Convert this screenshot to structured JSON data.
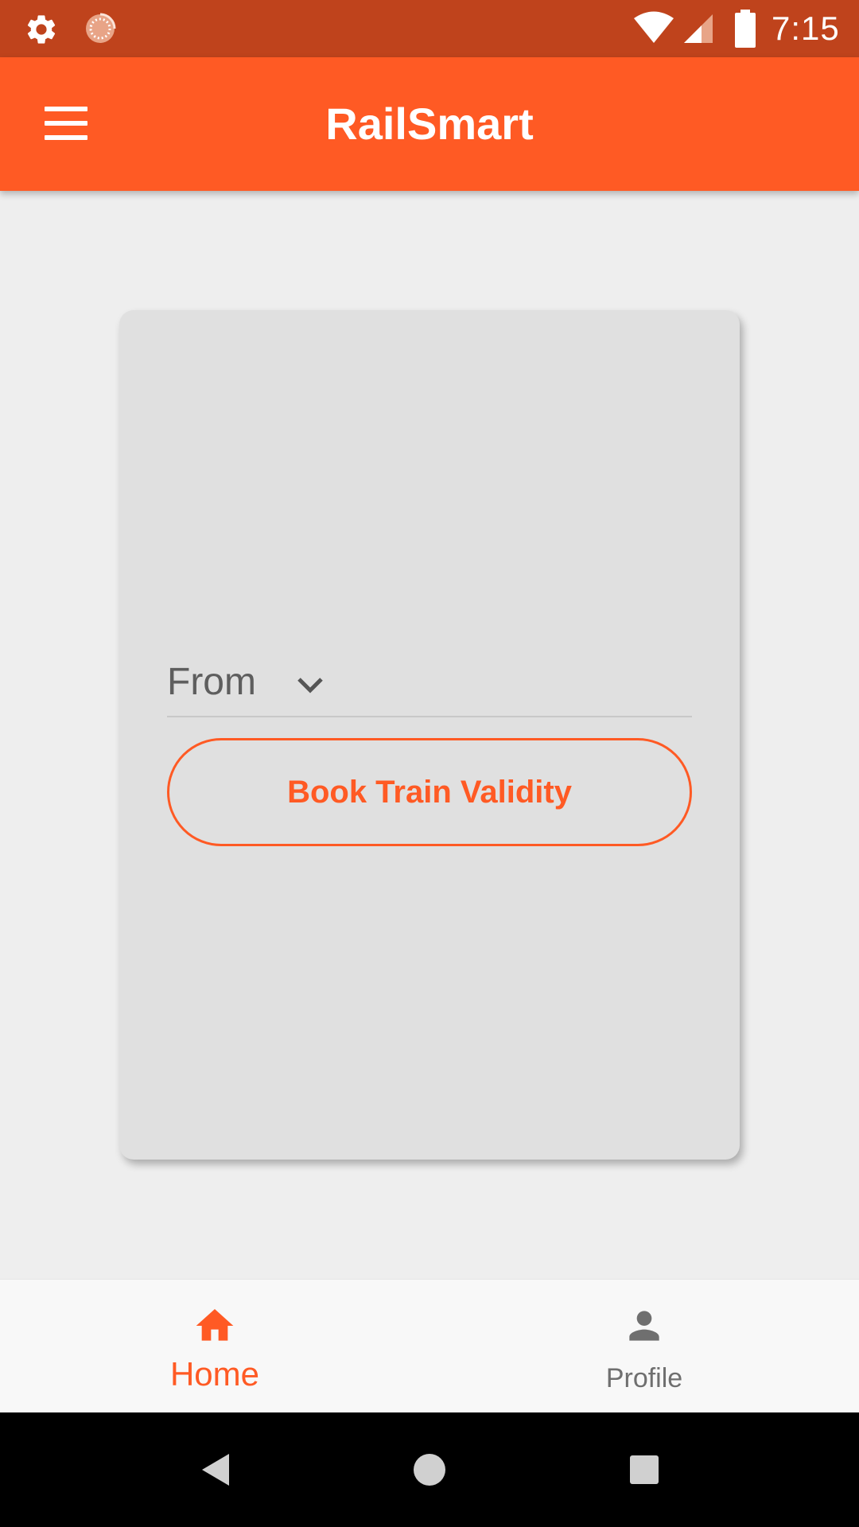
{
  "status_bar": {
    "time": "7:15",
    "icons": [
      "gear-icon",
      "sync-icon",
      "wifi-icon",
      "signal-icon",
      "battery-icon"
    ]
  },
  "app_bar": {
    "title": "RailSmart",
    "menu_icon": "hamburger-menu-icon"
  },
  "card": {
    "from_dropdown": {
      "label": "From",
      "icon": "chevron-down-icon"
    },
    "book_button_label": "Book Train Validity"
  },
  "bottom_nav": {
    "items": [
      {
        "label": "Home",
        "icon": "home-icon",
        "active": true
      },
      {
        "label": "Profile",
        "icon": "person-icon",
        "active": false
      }
    ]
  },
  "system_nav": {
    "buttons": [
      "back-icon",
      "home-circle-icon",
      "recents-icon"
    ]
  },
  "colors": {
    "primary": "#ff5a24",
    "status_bar": "#bf431c",
    "background": "#eeeeee",
    "card": "#e0e0e0",
    "inactive": "#6f6f6f"
  }
}
